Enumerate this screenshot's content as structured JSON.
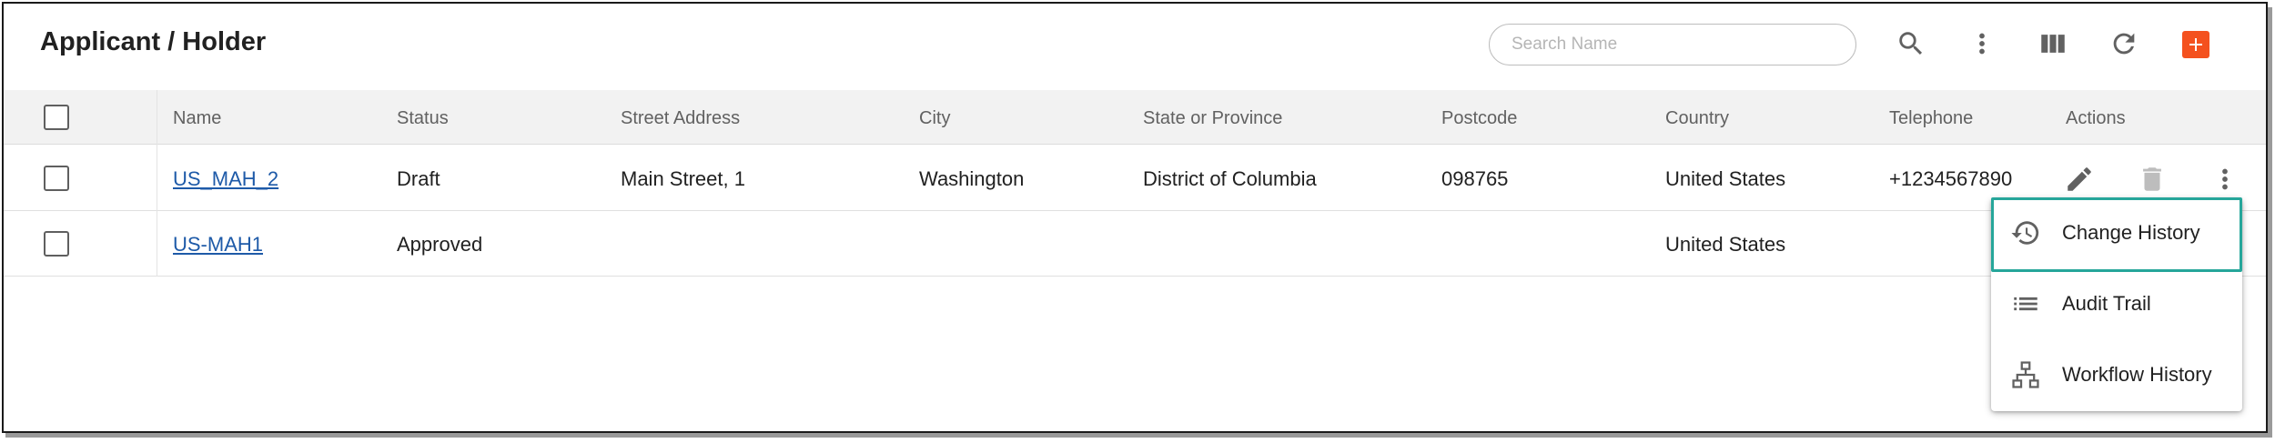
{
  "header": {
    "title": "Applicant / Holder",
    "search_placeholder": "Search Name"
  },
  "toolbar": {
    "icons": [
      "search-icon",
      "more-vert-icon",
      "columns-icon",
      "refresh-icon",
      "add-icon"
    ],
    "accent_color": "#f4511e"
  },
  "table": {
    "columns": [
      "Name",
      "Status",
      "Street Address",
      "City",
      "State or Province",
      "Postcode",
      "Country",
      "Telephone",
      "Actions"
    ],
    "rows": [
      {
        "name": "US_MAH_2",
        "status": "Draft",
        "street": "Main Street, 1",
        "city": "Washington",
        "state": "District of Columbia",
        "postcode": "098765",
        "country": "United States",
        "telephone": "+1234567890"
      },
      {
        "name": "US-MAH1",
        "status": "Approved",
        "street": "",
        "city": "",
        "state": "",
        "postcode": "",
        "country": "United States",
        "telephone": ""
      }
    ]
  },
  "menu": {
    "items": [
      {
        "label": "Change History",
        "icon": "history-icon"
      },
      {
        "label": "Audit Trail",
        "icon": "list-icon"
      },
      {
        "label": "Workflow History",
        "icon": "workflow-icon"
      }
    ],
    "highlight_color": "#26a69a"
  }
}
